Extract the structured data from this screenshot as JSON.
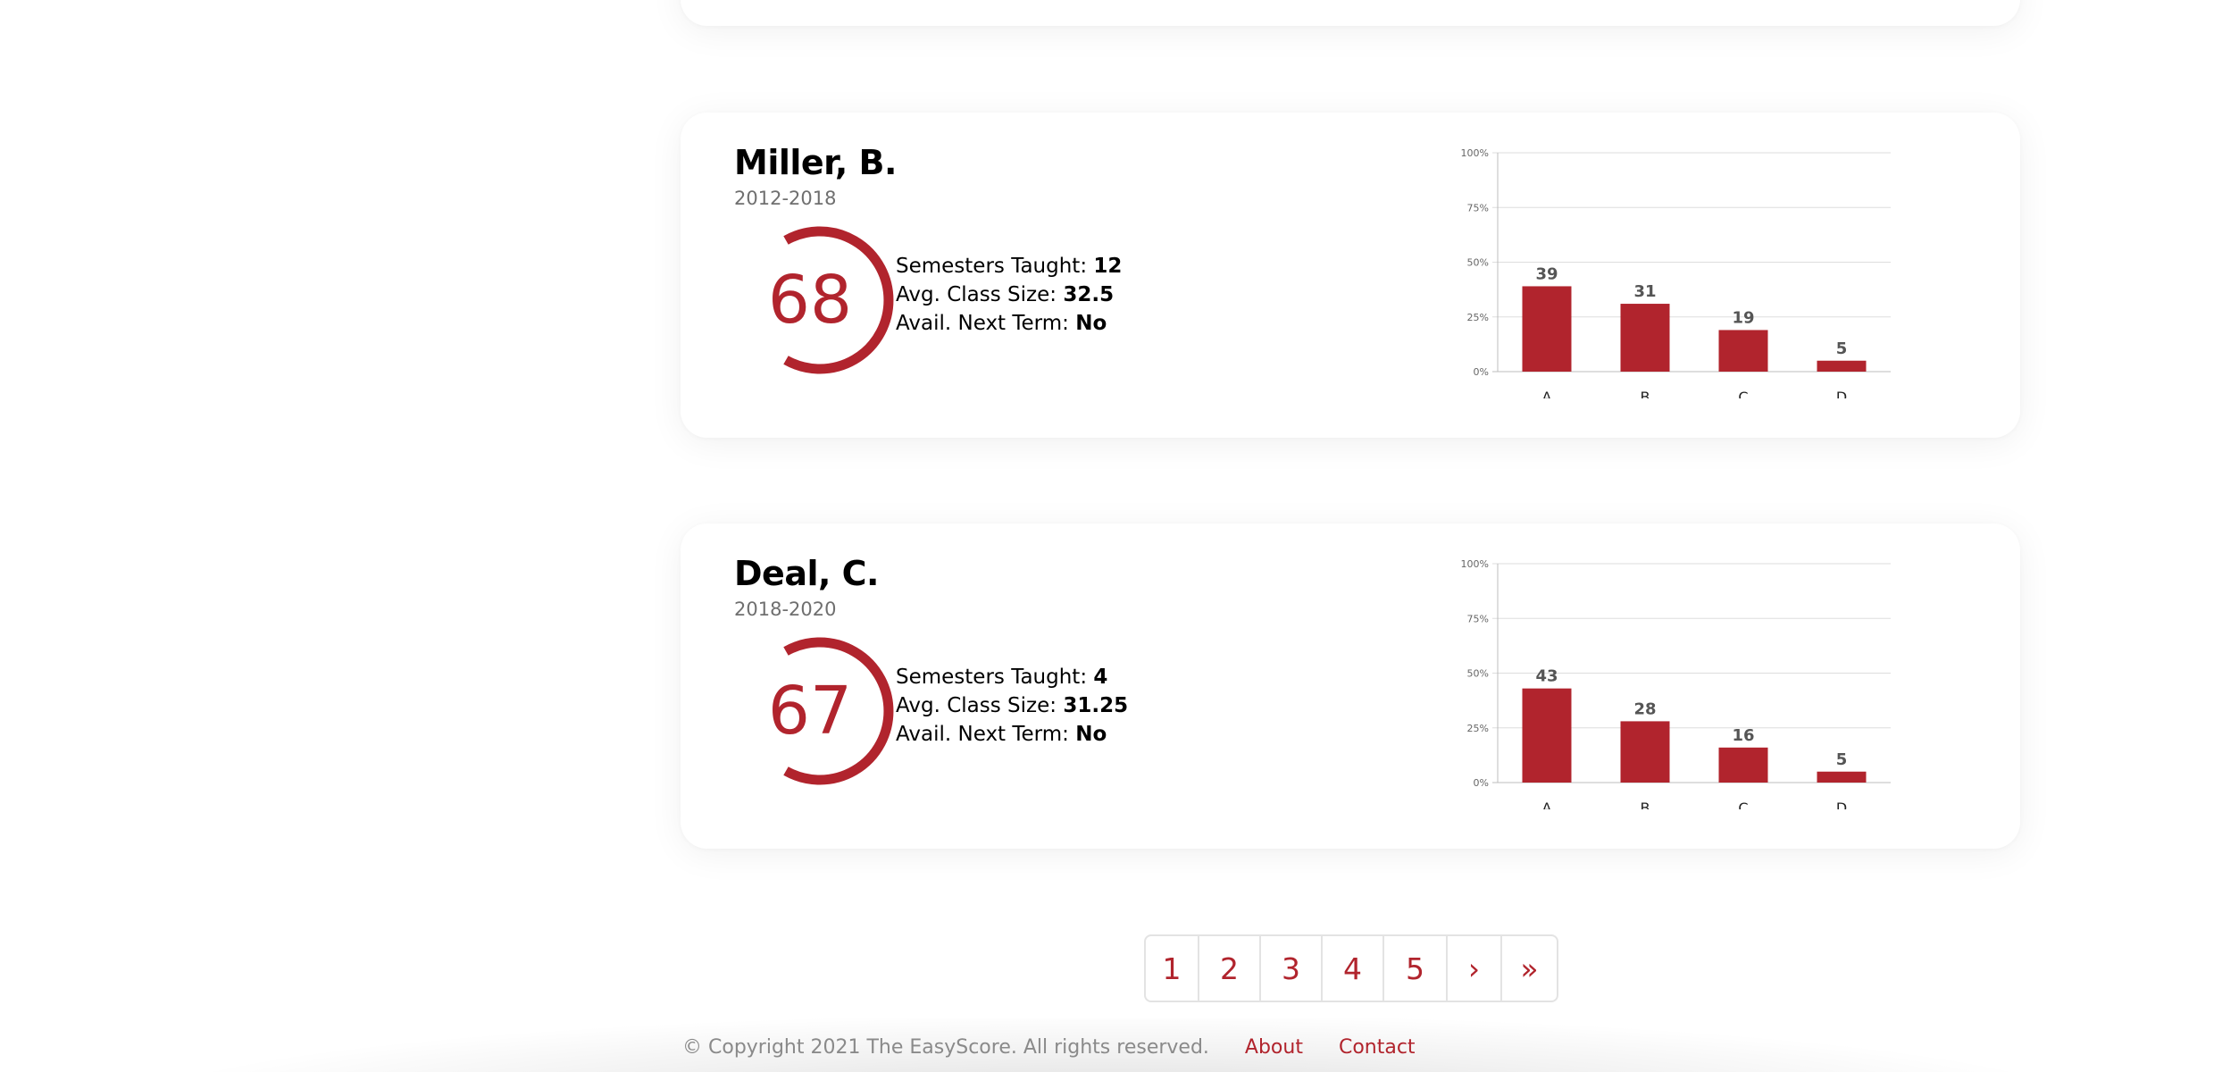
{
  "brand_color": "#b1242d",
  "professors": [
    {
      "name": "Miller, B.",
      "years": "2012-2018",
      "score": "68",
      "stats": {
        "semesters_label": "Semesters Taught:",
        "semesters_value": "12",
        "class_size_label": "Avg. Class Size:",
        "class_size_value": "32.5",
        "avail_label": "Avail. Next Term:",
        "avail_value": "No"
      }
    },
    {
      "name": "Deal, C.",
      "years": "2018-2020",
      "score": "67",
      "stats": {
        "semesters_label": "Semesters Taught:",
        "semesters_value": "4",
        "class_size_label": "Avg. Class Size:",
        "class_size_value": "31.25",
        "avail_label": "Avail. Next Term:",
        "avail_value": "No"
      }
    }
  ],
  "chart_data": [
    {
      "type": "bar",
      "categories": [
        "A",
        "B",
        "C",
        "D"
      ],
      "values": [
        39,
        31,
        19,
        5
      ],
      "ylim": [
        0,
        100
      ],
      "yticks": [
        "0%",
        "25%",
        "50%",
        "75%",
        "100%"
      ],
      "grid": true,
      "color": "#b1242d"
    },
    {
      "type": "bar",
      "categories": [
        "A",
        "B",
        "C",
        "D"
      ],
      "values": [
        43,
        28,
        16,
        5
      ],
      "ylim": [
        0,
        100
      ],
      "yticks": [
        "0%",
        "25%",
        "50%",
        "75%",
        "100%"
      ],
      "grid": true,
      "color": "#b1242d"
    }
  ],
  "pagination": {
    "pages": [
      "1",
      "2",
      "3",
      "4",
      "5"
    ],
    "next": "›",
    "last": "»"
  },
  "footer": {
    "copyright": "© Copyright 2021 The EasyScore. All rights reserved.",
    "about": "About",
    "contact": "Contact"
  }
}
